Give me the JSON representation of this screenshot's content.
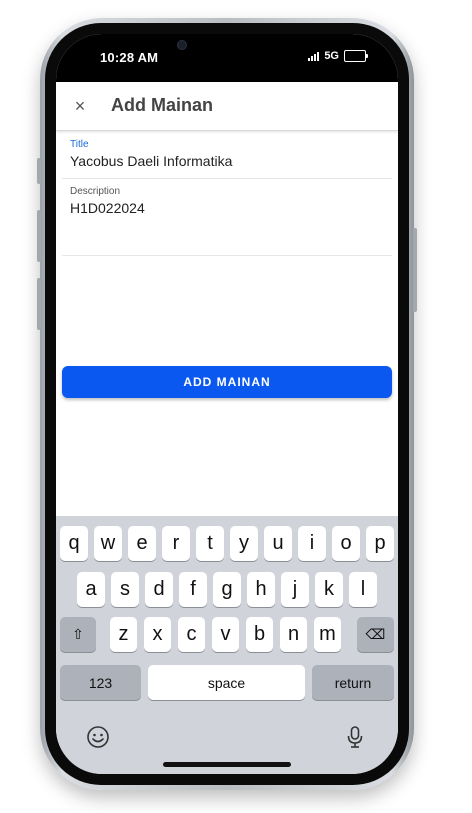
{
  "status_bar": {
    "time": "10:28 AM",
    "network": "5G"
  },
  "app_bar": {
    "title": "Add Mainan",
    "close_icon": "close-icon",
    "close_glyph": "×"
  },
  "form": {
    "title_label": "Title",
    "title_value": "Yacobus Daeli Informatika",
    "description_label": "Description",
    "description_value": "H1D022024",
    "submit_label": "ADD MAINAN"
  },
  "keyboard": {
    "row1": [
      "q",
      "w",
      "e",
      "r",
      "t",
      "y",
      "u",
      "i",
      "o",
      "p"
    ],
    "row2": [
      "a",
      "s",
      "d",
      "f",
      "g",
      "h",
      "j",
      "k",
      "l"
    ],
    "row3": [
      "z",
      "x",
      "c",
      "v",
      "b",
      "n",
      "m"
    ],
    "shift_glyph": "⇧",
    "backspace_glyph": "⌫",
    "numbers_label": "123",
    "space_label": "space",
    "return_label": "return",
    "emoji_icon": "emoji-icon",
    "mic_icon": "microphone-icon"
  },
  "colors": {
    "accent": "#0a58f0",
    "label_focus": "#1a6ad6",
    "keyboard_bg": "#d1d3da"
  }
}
